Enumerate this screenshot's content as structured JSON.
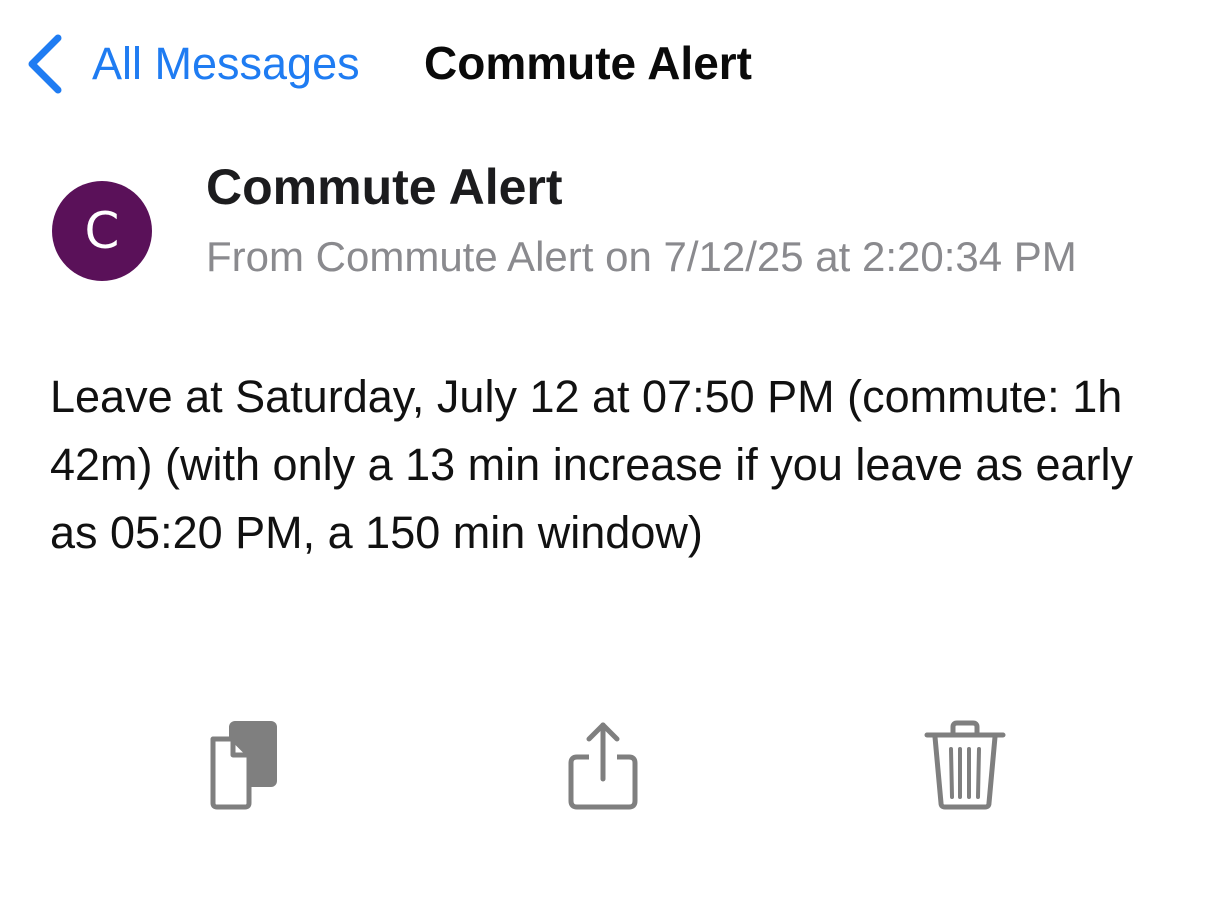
{
  "nav": {
    "back_label": "All Messages",
    "title": "Commute Alert"
  },
  "message": {
    "avatar_initial": "C",
    "avatar_color": "#5a1159",
    "sender": "Commute Alert",
    "meta": "From Commute Alert on 7/12/25 at 2:20:34 PM",
    "body": "Leave at Saturday, July 12 at 07:50 PM (commute: 1h 42m) (with only a 13 min increase if you leave as early as 05:20 PM, a 150 min window)"
  },
  "actions": {
    "copy_icon": "copy-icon",
    "share_icon": "share-icon",
    "delete_icon": "trash-icon"
  },
  "colors": {
    "accent": "#1f7cf2",
    "icon_gray": "#7f7f7f",
    "meta_gray": "#8a8a8e"
  }
}
